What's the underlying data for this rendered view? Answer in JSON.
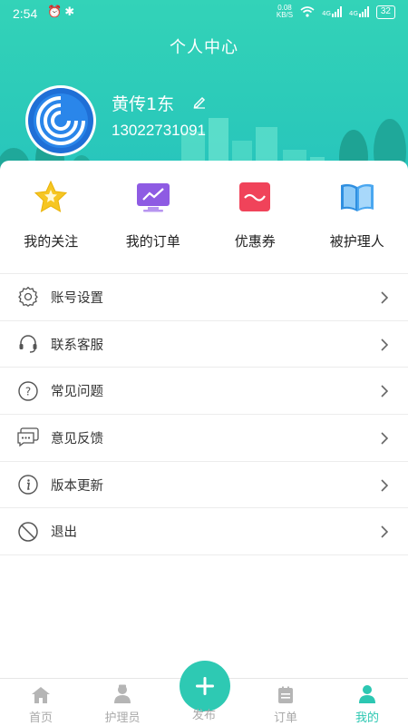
{
  "status": {
    "time": "2:54",
    "net_speed_value": "0.08",
    "net_speed_unit": "KB/S",
    "network_type_1": "4G",
    "network_type_2": "4G",
    "battery": "32"
  },
  "header": {
    "title": "个人中心",
    "username": "黄传1东",
    "phone": "13022731091"
  },
  "quick_actions": [
    {
      "label": "我的关注",
      "icon": "star-icon",
      "color": "#f5c518"
    },
    {
      "label": "我的订单",
      "icon": "monitor-chart-icon",
      "color": "#8e5be3"
    },
    {
      "label": "优惠券",
      "icon": "coupon-icon",
      "color": "#f0435a"
    },
    {
      "label": "被护理人",
      "icon": "book-icon",
      "color": "#2f8fe0"
    }
  ],
  "menu": [
    {
      "label": "账号设置",
      "icon": "gear-icon"
    },
    {
      "label": "联系客服",
      "icon": "headset-icon"
    },
    {
      "label": "常见问题",
      "icon": "question-icon"
    },
    {
      "label": "意见反馈",
      "icon": "feedback-chat-icon"
    },
    {
      "label": "版本更新",
      "icon": "info-icon"
    },
    {
      "label": "退出",
      "icon": "ban-icon"
    }
  ],
  "tabbar": {
    "home": "首页",
    "caregiver": "护理员",
    "publish": "发布",
    "orders": "订单",
    "mine": "我的",
    "active_color": "#2cc7b2"
  },
  "colors": {
    "header_bg": "#2ccbb9",
    "accent": "#2ec9b3"
  }
}
